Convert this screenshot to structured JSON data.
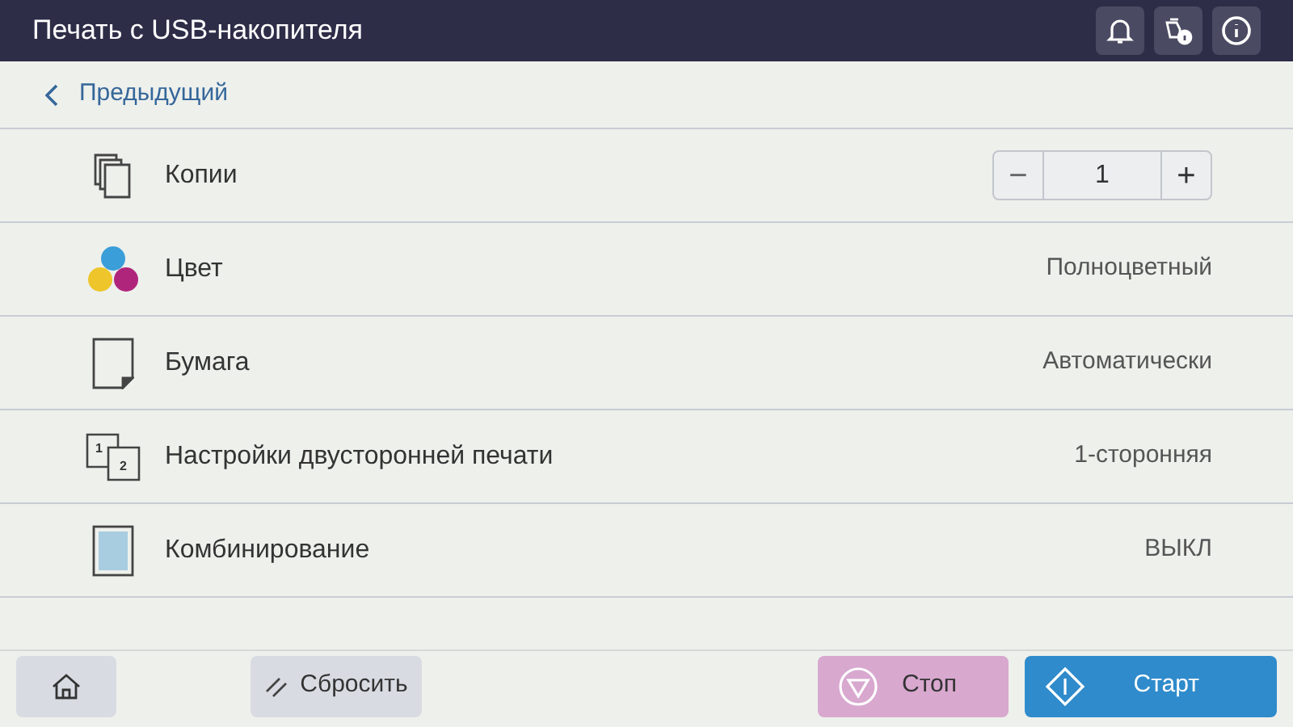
{
  "header": {
    "title": "Печать с USB-накопителя"
  },
  "back": {
    "label": "Предыдущий"
  },
  "settings": [
    {
      "kind": "stepper",
      "label": "Копии",
      "value": "1",
      "minus": "−",
      "plus": "+"
    },
    {
      "kind": "value",
      "label": "Цвет",
      "value": "Полноцветный"
    },
    {
      "kind": "value",
      "label": "Бумага",
      "value": "Автоматически"
    },
    {
      "kind": "value",
      "label": "Настройки двусторонней печати",
      "value": "1-сторонняя",
      "icon_labels": [
        "1",
        "2"
      ]
    },
    {
      "kind": "value",
      "label": "Комбинирование",
      "value": "ВЫКЛ"
    }
  ],
  "footer": {
    "reset": "Сбросить",
    "stop": "Стоп",
    "start": "Старт"
  }
}
